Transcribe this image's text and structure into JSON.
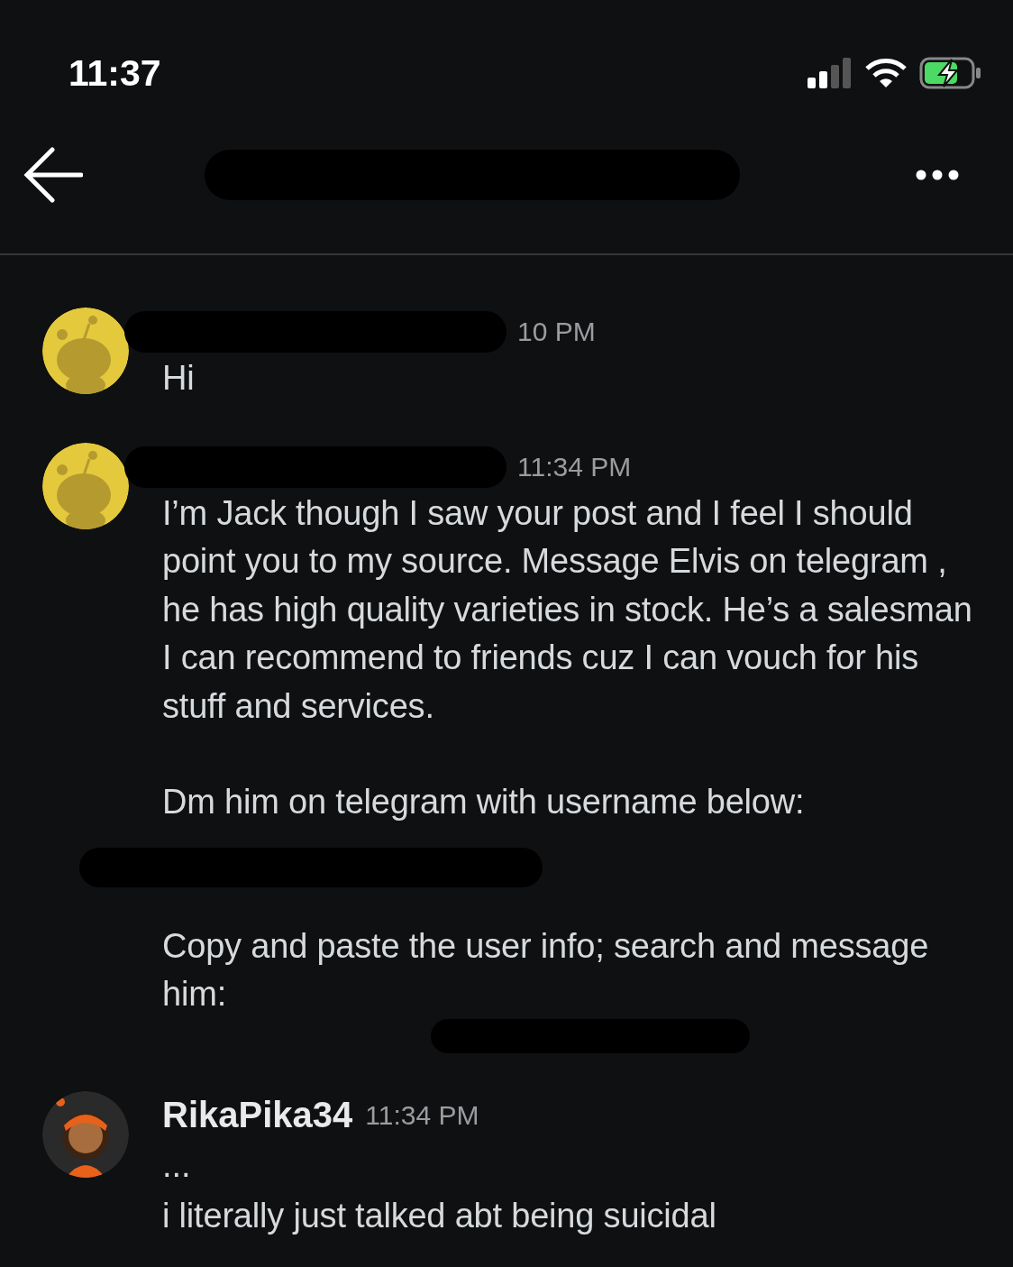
{
  "status_bar": {
    "time": "11:37",
    "battery_charging": true
  },
  "header": {
    "title_redacted": true
  },
  "messages": [
    {
      "avatar": {
        "kind": "snoo"
      },
      "author_redacted": true,
      "time": "10 PM",
      "body": [
        {
          "kind": "text",
          "text": "Hi"
        }
      ]
    },
    {
      "avatar": {
        "kind": "snoo"
      },
      "author_redacted": true,
      "time": "11:34 PM",
      "body": [
        {
          "kind": "text",
          "text": "I’m Jack though I saw your post and I feel I should point you to my source. Message Elvis on telegram , he has high quality varieties in stock. He’s a salesman I can recommend to friends cuz I can vouch for his stuff and services."
        },
        {
          "kind": "text",
          "text": "Dm him on telegram with username below:"
        },
        {
          "kind": "redacted"
        },
        {
          "kind": "text",
          "text": "Copy and paste the user info; search and message him:",
          "tail_redacted": true
        }
      ]
    },
    {
      "avatar": {
        "kind": "figure"
      },
      "author": "RikaPika34",
      "time": "11:34 PM",
      "ellipsis": "...",
      "body": [
        {
          "kind": "text",
          "text": "i literally just talked abt being suicidal"
        }
      ]
    }
  ]
}
